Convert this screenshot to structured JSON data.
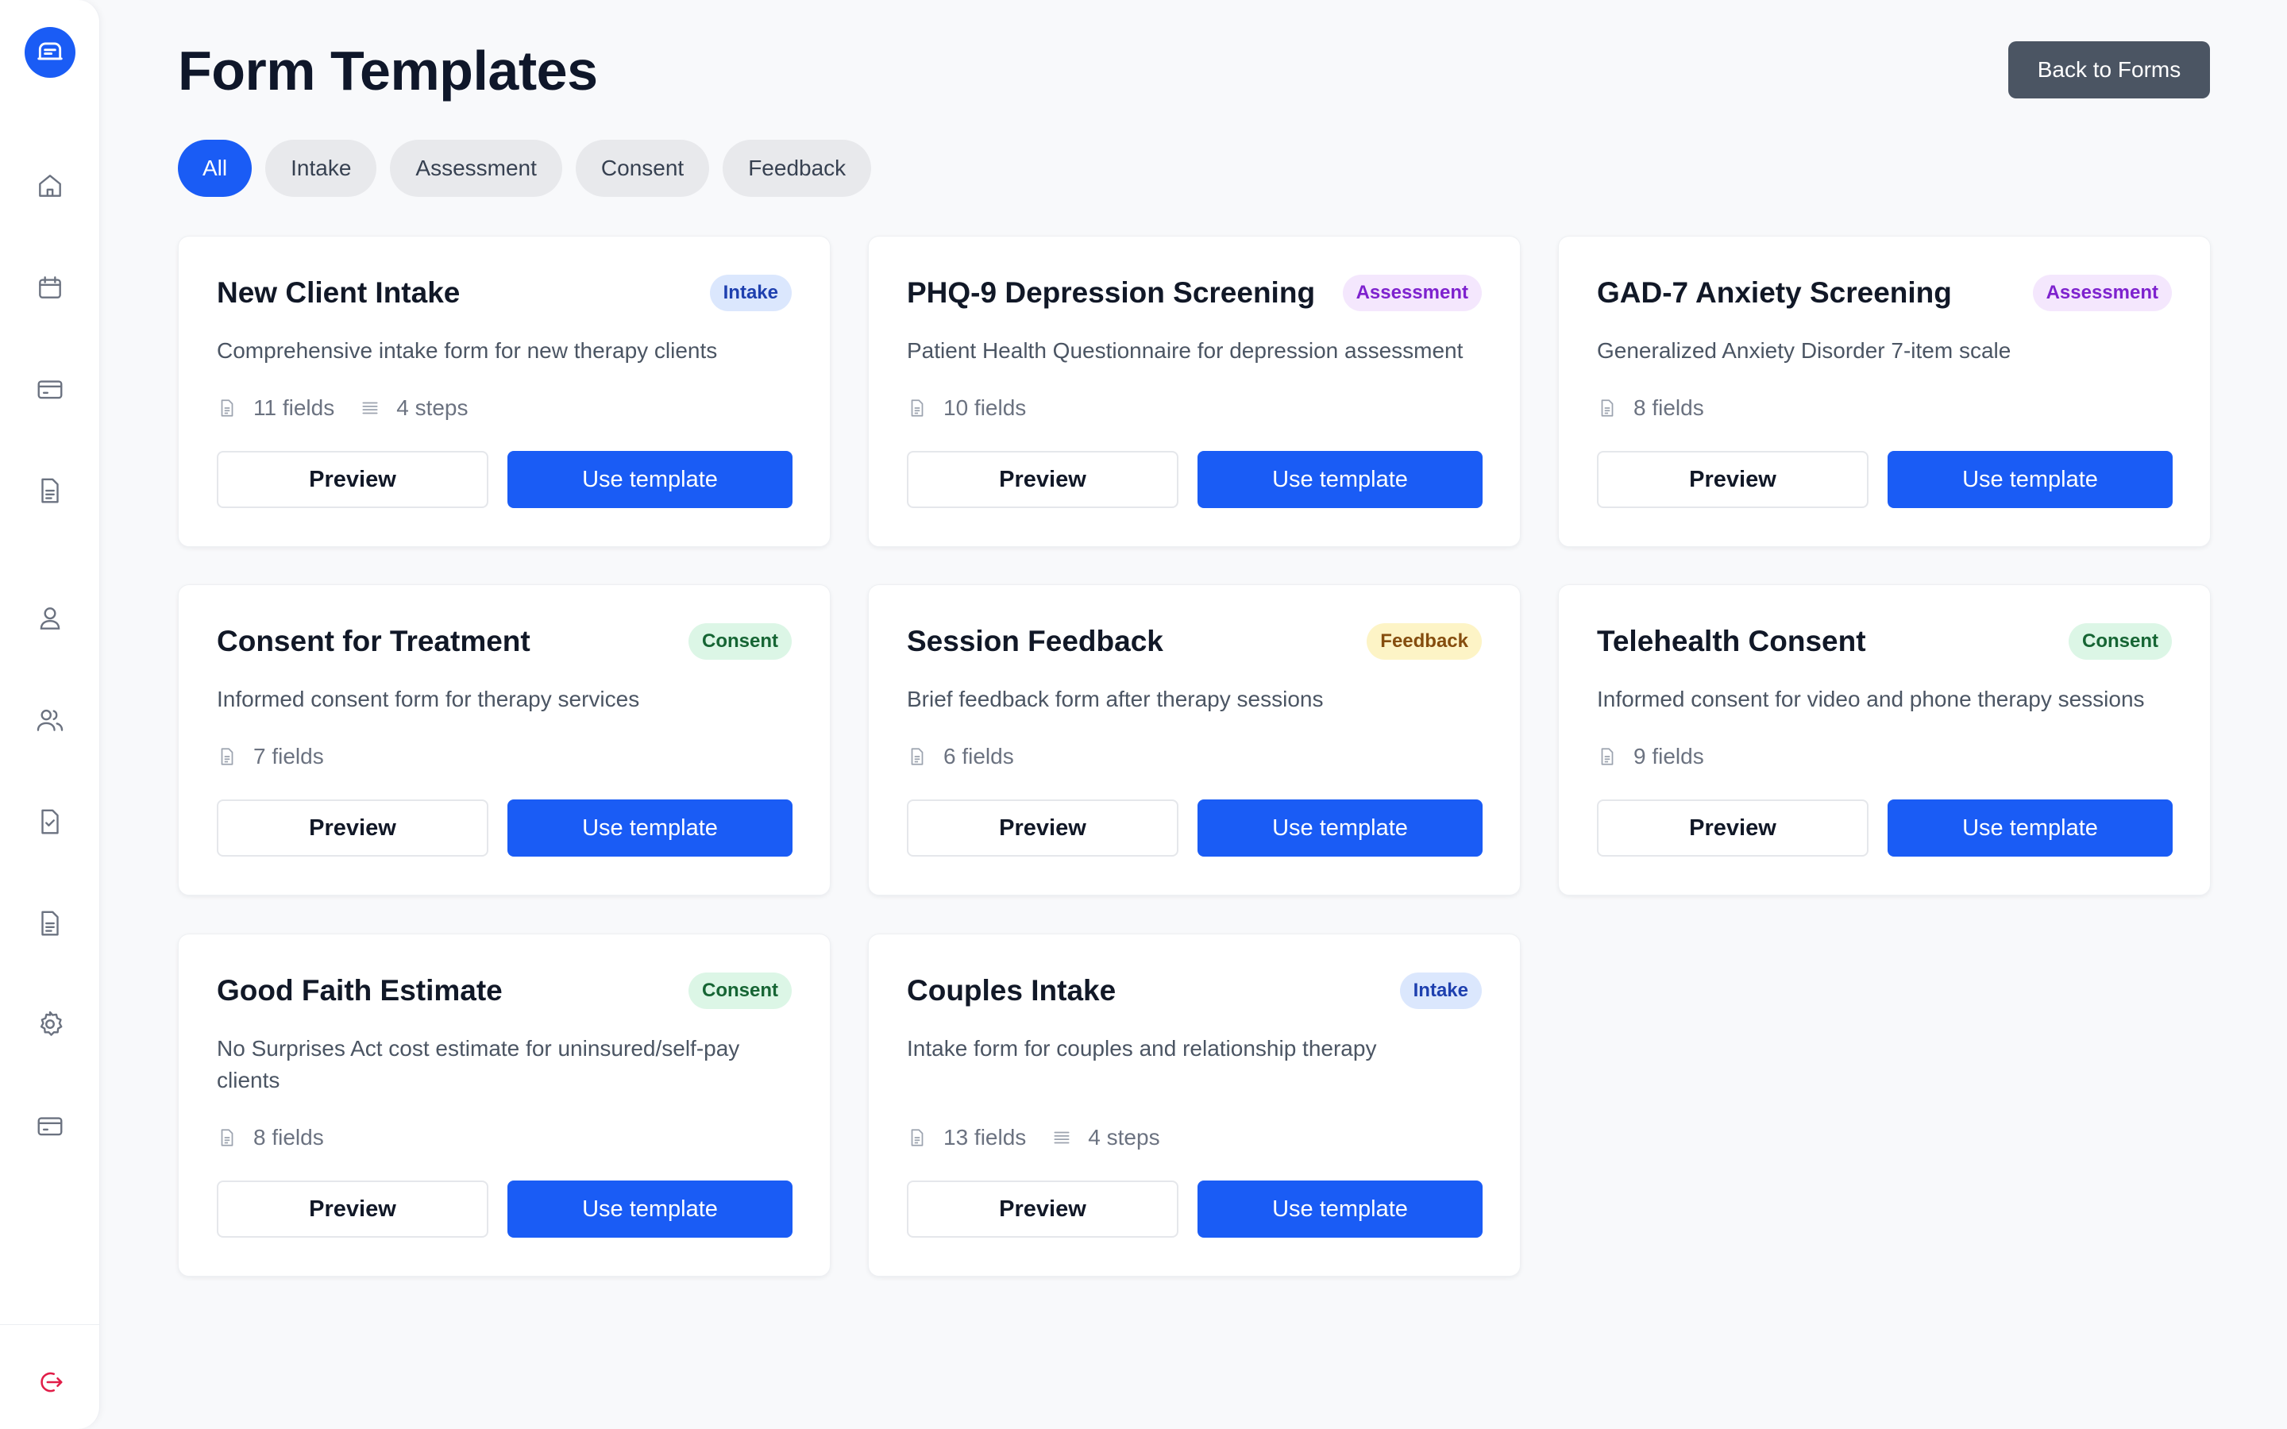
{
  "page": {
    "title": "Form Templates",
    "back_label": "Back to Forms"
  },
  "sidebar": {
    "items": [
      {
        "icon": "home-icon"
      },
      {
        "icon": "calendar-icon"
      },
      {
        "icon": "card-icon"
      },
      {
        "icon": "document-icon"
      },
      {
        "icon": "user-icon"
      },
      {
        "icon": "users-icon"
      },
      {
        "icon": "clipboard-check-icon"
      },
      {
        "icon": "file-text-icon"
      },
      {
        "icon": "gear-icon"
      },
      {
        "icon": "billing-icon"
      }
    ],
    "logout_icon": "logout-icon"
  },
  "filters": [
    "All",
    "Intake",
    "Assessment",
    "Consent",
    "Feedback"
  ],
  "active_filter": "All",
  "colors": {
    "primary": "#1a5cf5",
    "back_button": "#4b5563"
  },
  "templates": [
    {
      "title": "New Client Intake",
      "category": "Intake",
      "description": "Comprehensive intake form for new therapy clients",
      "fields": "11 fields",
      "steps": "4 steps",
      "preview": "Preview",
      "use": "Use template"
    },
    {
      "title": "PHQ-9 Depression Screening",
      "category": "Assessment",
      "description": "Patient Health Questionnaire for depression assessment",
      "fields": "10 fields",
      "preview": "Preview",
      "use": "Use template"
    },
    {
      "title": "GAD-7 Anxiety Screening",
      "category": "Assessment",
      "description": "Generalized Anxiety Disorder 7-item scale",
      "fields": "8 fields",
      "preview": "Preview",
      "use": "Use template"
    },
    {
      "title": "Consent for Treatment",
      "category": "Consent",
      "description": "Informed consent form for therapy services",
      "fields": "7 fields",
      "preview": "Preview",
      "use": "Use template"
    },
    {
      "title": "Session Feedback",
      "category": "Feedback",
      "description": "Brief feedback form after therapy sessions",
      "fields": "6 fields",
      "preview": "Preview",
      "use": "Use template"
    },
    {
      "title": "Telehealth Consent",
      "category": "Consent",
      "description": "Informed consent for video and phone therapy sessions",
      "fields": "9 fields",
      "preview": "Preview",
      "use": "Use template"
    },
    {
      "title": "Good Faith Estimate",
      "category": "Consent",
      "description": "No Surprises Act cost estimate for uninsured/self-pay clients",
      "fields": "8 fields",
      "preview": "Preview",
      "use": "Use template"
    },
    {
      "title": "Couples Intake",
      "category": "Intake",
      "description": "Intake form for couples and relationship therapy",
      "fields": "13 fields",
      "steps": "4 steps",
      "preview": "Preview",
      "use": "Use template"
    }
  ]
}
